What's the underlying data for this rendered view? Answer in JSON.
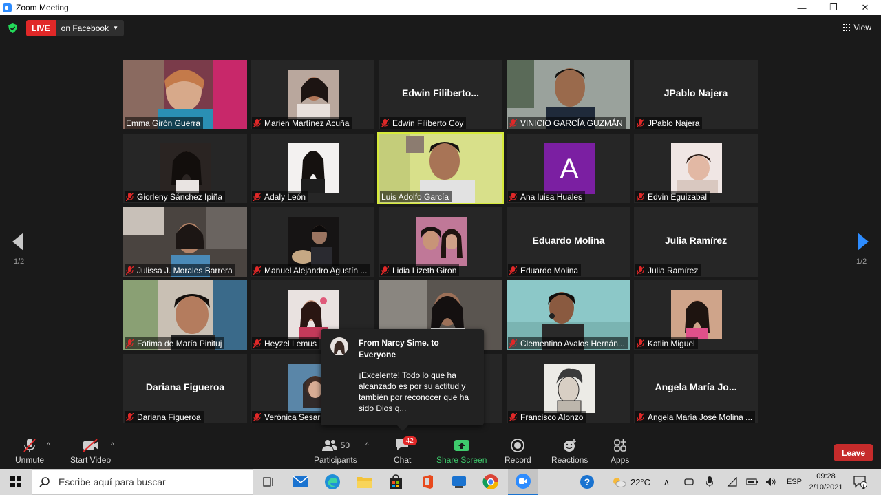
{
  "window": {
    "title": "Zoom Meeting",
    "controls": [
      "—",
      "❐",
      "✕"
    ]
  },
  "live": {
    "tag": "LIVE",
    "platform": "on Facebook"
  },
  "view_label": "View",
  "pagination": {
    "left": "1/2",
    "right": "1/2"
  },
  "tiles": [
    {
      "name": "Emma Girón Guerra",
      "muted": false,
      "kind": "video"
    },
    {
      "name": "Marien Martínez Acuña",
      "muted": true,
      "kind": "photo"
    },
    {
      "name": "Edwin Filiberto Coy",
      "display": "Edwin  Filiberto...",
      "muted": true,
      "kind": "text"
    },
    {
      "name": "VINICIO GARCÍA GUZMÁN",
      "muted": true,
      "kind": "video"
    },
    {
      "name": "JPablo Najera",
      "display": "JPablo Najera",
      "muted": true,
      "kind": "text"
    },
    {
      "name": "Giorleny Sánchez Ipiña",
      "muted": true,
      "kind": "photo"
    },
    {
      "name": "Adaly León",
      "muted": true,
      "kind": "photo"
    },
    {
      "name": "Luis Adolfo García",
      "muted": false,
      "kind": "video",
      "active": true
    },
    {
      "name": "Ana luisa Huales",
      "muted": true,
      "kind": "avatar",
      "initial": "A"
    },
    {
      "name": "Edvin Eguizabal",
      "muted": true,
      "kind": "photo"
    },
    {
      "name": "Julissa J. Morales Barrera",
      "muted": true,
      "kind": "video"
    },
    {
      "name": "Manuel Alejandro Agustín ...",
      "muted": true,
      "kind": "photo"
    },
    {
      "name": "Lidia Lizeth Giron",
      "muted": true,
      "kind": "photo"
    },
    {
      "name": "Eduardo Molina",
      "display": "Eduardo Molina",
      "muted": true,
      "kind": "text"
    },
    {
      "name": "Julia Ramírez",
      "display": "Julia Ramírez",
      "muted": true,
      "kind": "text"
    },
    {
      "name": "Fátima de María Pinituj",
      "muted": true,
      "kind": "video"
    },
    {
      "name": "Heyzel Lemus",
      "muted": true,
      "kind": "photo"
    },
    {
      "name": "",
      "muted": false,
      "kind": "video"
    },
    {
      "name": "Clementino Avalos Hernán...",
      "muted": true,
      "kind": "video"
    },
    {
      "name": "Katlin Miguel",
      "muted": true,
      "kind": "photo"
    },
    {
      "name": "Dariana Figueroa",
      "display": "Dariana Figueroa",
      "muted": true,
      "kind": "text"
    },
    {
      "name": "Verónica Sesar",
      "muted": true,
      "kind": "photo"
    },
    {
      "name": "",
      "muted": false,
      "kind": "hidden"
    },
    {
      "name": "Francisco Alonzo",
      "muted": true,
      "kind": "photo"
    },
    {
      "name": "Angela María José Molina ...",
      "display": "Angela  María  Jo...",
      "muted": true,
      "kind": "text"
    }
  ],
  "chat_popup": {
    "from": "From Narcy Sime. to Everyone",
    "message": "¡Excelente! Todo lo que ha alcanzado es por su actitud y también por reconocer que ha sido Dios q..."
  },
  "toolbar": {
    "unmute": "Unmute",
    "start_video": "Start Video",
    "participants": "Participants",
    "participants_count": "50",
    "chat": "Chat",
    "chat_badge": "42",
    "share_screen": "Share Screen",
    "record": "Record",
    "reactions": "Reactions",
    "apps": "Apps",
    "leave": "Leave"
  },
  "taskbar": {
    "search_placeholder": "Escribe aquí para buscar",
    "temperature": "22°C",
    "language": "ESP",
    "time": "09:28",
    "date": "2/10/2021",
    "notification_count": "1"
  },
  "colors": {
    "live_red": "#e02828",
    "accent_blue": "#2d8cff",
    "share_green": "#3ecb6c",
    "active_speaker": "#d6ea3b",
    "leave_red": "#c62b2b"
  }
}
